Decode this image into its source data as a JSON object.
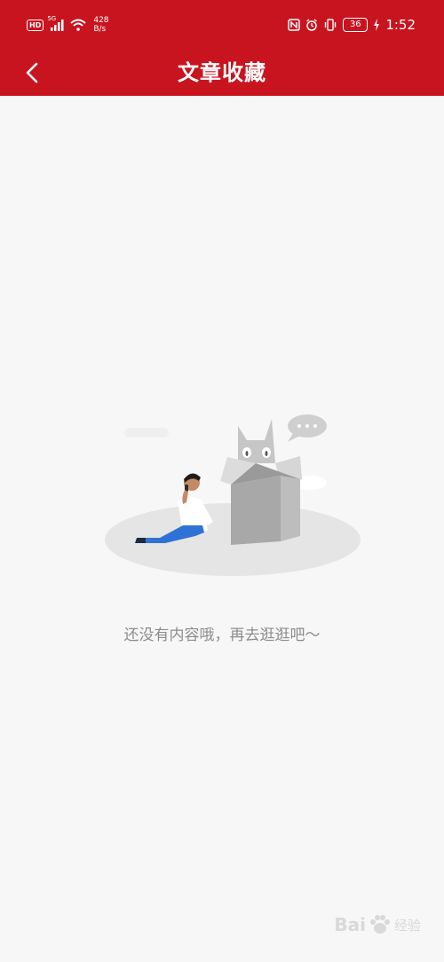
{
  "status_bar": {
    "hd": "HD",
    "network": "5G",
    "speed_value": "428",
    "speed_unit": "B/s",
    "battery": "36",
    "time": "1:52"
  },
  "nav": {
    "title": "文章收藏"
  },
  "empty_state": {
    "message": "还没有内容哦，再去逛逛吧～"
  },
  "watermark": {
    "brand": "Bai",
    "sub": "经验"
  },
  "colors": {
    "header_bg": "#c8141f",
    "page_bg": "#f7f7f7",
    "message_text": "#8c8c8c"
  }
}
